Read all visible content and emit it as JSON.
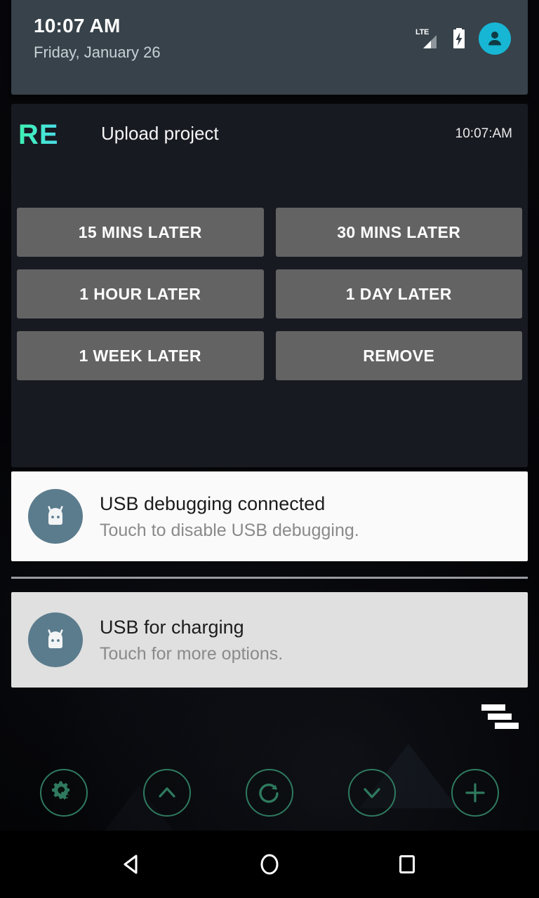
{
  "statusbar": {
    "time": "10:07 AM",
    "date": "Friday, January 26",
    "network_label": "LTE",
    "signal_icon": "signal-triangle-icon",
    "battery_icon": "battery-charging-icon",
    "avatar_icon": "user-avatar-icon"
  },
  "app_notification": {
    "logo_text": "RE",
    "title": "Upload project",
    "time": "10:07:AM",
    "actions": [
      {
        "label": "15 MINS LATER",
        "name": "action-15-mins-later"
      },
      {
        "label": "30 MINS LATER",
        "name": "action-30-mins-later"
      },
      {
        "label": "1 HOUR LATER",
        "name": "action-1-hour-later"
      },
      {
        "label": "1 DAY LATER",
        "name": "action-1-day-later"
      },
      {
        "label": "1 WEEK LATER",
        "name": "action-1-week-later"
      },
      {
        "label": "REMOVE",
        "name": "action-remove"
      }
    ]
  },
  "system_notifications": [
    {
      "title": "USB debugging connected",
      "subtitle": "Touch to disable USB debugging.",
      "icon": "android-robot-icon"
    },
    {
      "title": "USB for charging",
      "subtitle": "Touch for more options.",
      "icon": "android-robot-icon"
    }
  ],
  "clear_all": {
    "icon": "clear-all-notifications-icon"
  },
  "controls": [
    {
      "icon": "gear-icon",
      "name": "control-settings"
    },
    {
      "icon": "chevron-up-icon",
      "name": "control-scroll-up"
    },
    {
      "icon": "refresh-icon",
      "name": "control-refresh"
    },
    {
      "icon": "chevron-down-icon",
      "name": "control-scroll-down"
    },
    {
      "icon": "plus-icon",
      "name": "control-add"
    }
  ],
  "navbar": [
    {
      "icon": "back-triangle-icon",
      "name": "nav-back"
    },
    {
      "icon": "home-circle-icon",
      "name": "nav-home"
    },
    {
      "icon": "recents-square-icon",
      "name": "nav-recents"
    }
  ],
  "colors": {
    "header_bg": "#37424a",
    "card_dark_bg": "#181a22",
    "action_button_bg": "#636363",
    "accent_teal": "#17b6d4",
    "logo_gradient_start": "#3ef0b0",
    "logo_gradient_end": "#4ad9e4",
    "control_outline": "#2f7a5f",
    "notif_light_bg": "#fafafa",
    "notif_gray_bg": "#e0e0e0"
  }
}
